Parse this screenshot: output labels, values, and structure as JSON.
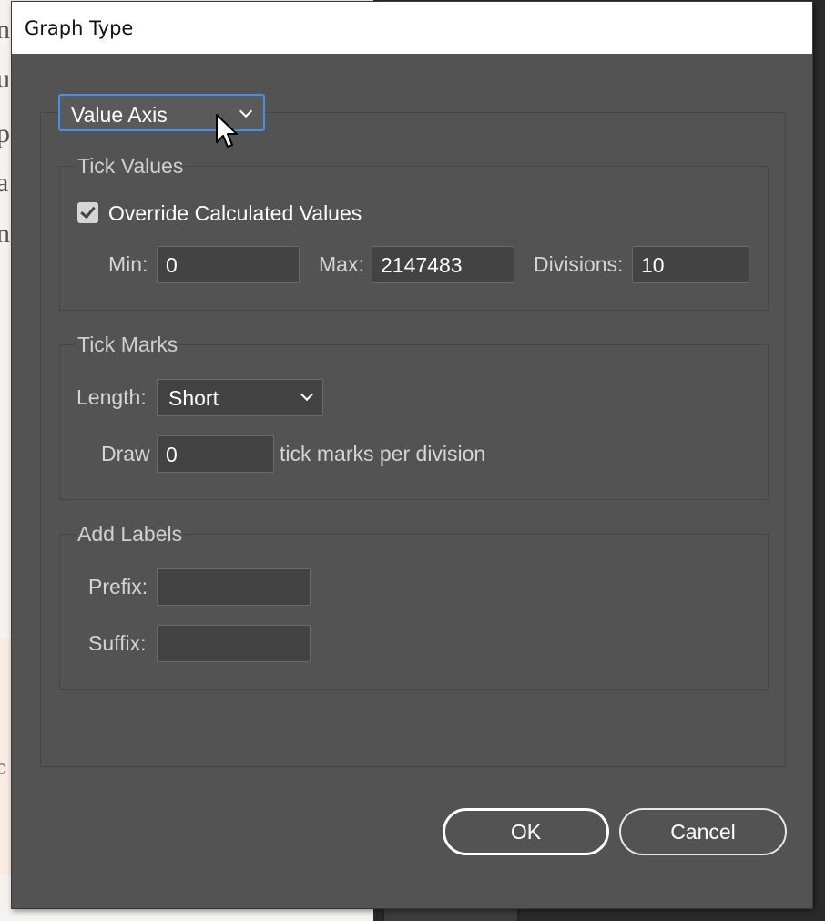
{
  "dialog": {
    "title": "Graph Type"
  },
  "axis_selector": {
    "value": "Value Axis"
  },
  "tick_values": {
    "title": "Tick Values",
    "override_label": "Override Calculated Values",
    "override_checked": true,
    "min_label": "Min:",
    "min_value": "0",
    "max_label": "Max:",
    "max_value": "2147483",
    "divisions_label": "Divisions:",
    "divisions_value": "10"
  },
  "tick_marks": {
    "title": "Tick Marks",
    "length_label": "Length:",
    "length_value": "Short",
    "draw_label": "Draw",
    "draw_value": "0",
    "draw_suffix": "tick marks per division"
  },
  "add_labels": {
    "title": "Add Labels",
    "prefix_label": "Prefix:",
    "prefix_value": "",
    "suffix_label": "Suffix:",
    "suffix_value": ""
  },
  "buttons": {
    "ok": "OK",
    "cancel": "Cancel"
  },
  "background": {
    "letters": [
      "n",
      "u",
      "p",
      "a",
      "n",
      "c"
    ]
  },
  "colors": {
    "dialog_bg": "#535353",
    "focus_ring": "#4a90e2",
    "field_bg": "#434343"
  },
  "icons": {
    "axis_dropdown": "chevron-down-icon",
    "length_dropdown": "chevron-down-icon",
    "override_checkbox": "checkmark-icon",
    "cursor": "mouse-pointer-icon"
  }
}
